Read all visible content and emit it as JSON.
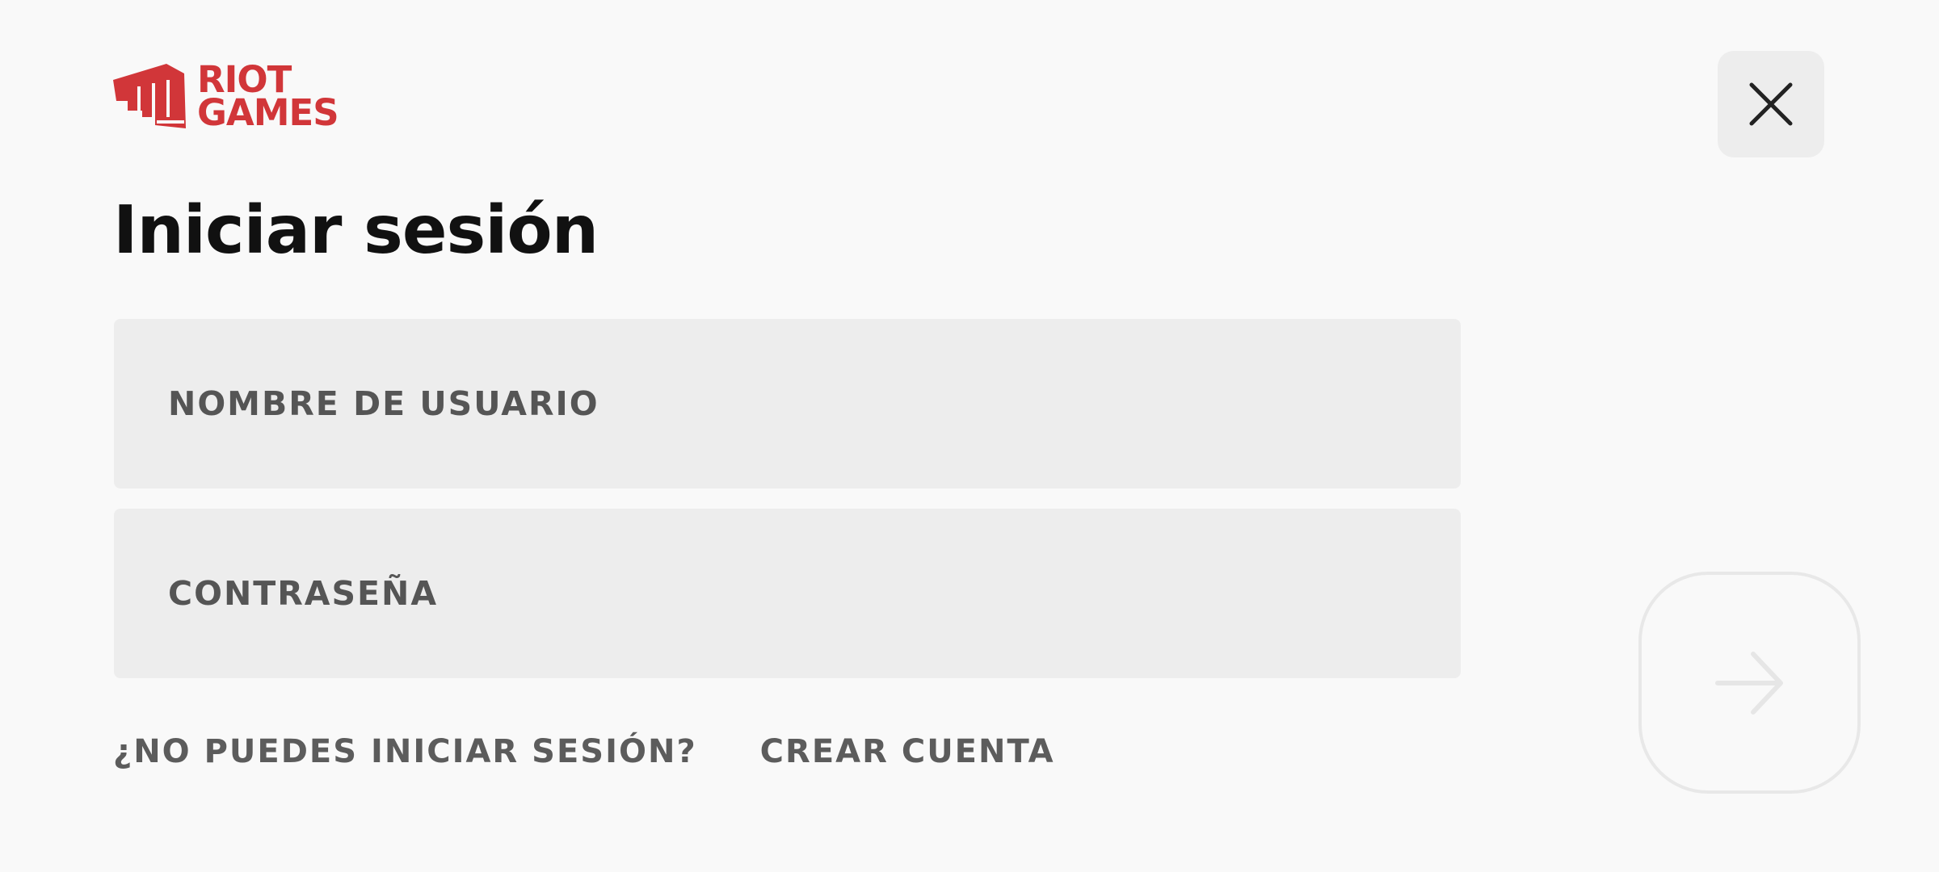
{
  "brand": {
    "name_line1": "RIOT",
    "name_line2": "GAMES",
    "logo_icon": "fist-icon",
    "color": "#d13639"
  },
  "page": {
    "title": "Iniciar sesión"
  },
  "form": {
    "username": {
      "placeholder": "NOMBRE DE USUARIO",
      "value": ""
    },
    "password": {
      "placeholder": "CONTRASEÑA",
      "value": ""
    },
    "submit_icon": "arrow-right-icon",
    "submit_enabled": false
  },
  "links": {
    "cant_sign_in": "¿NO PUEDES INICIAR SESIÓN?",
    "create_account": "CREAR CUENTA"
  },
  "window": {
    "close_icon": "close-icon"
  },
  "colors": {
    "background": "#f9f9f9",
    "field_background": "#ededed",
    "text_muted": "#5c5c5c",
    "title": "#111111",
    "accent": "#d13639"
  }
}
